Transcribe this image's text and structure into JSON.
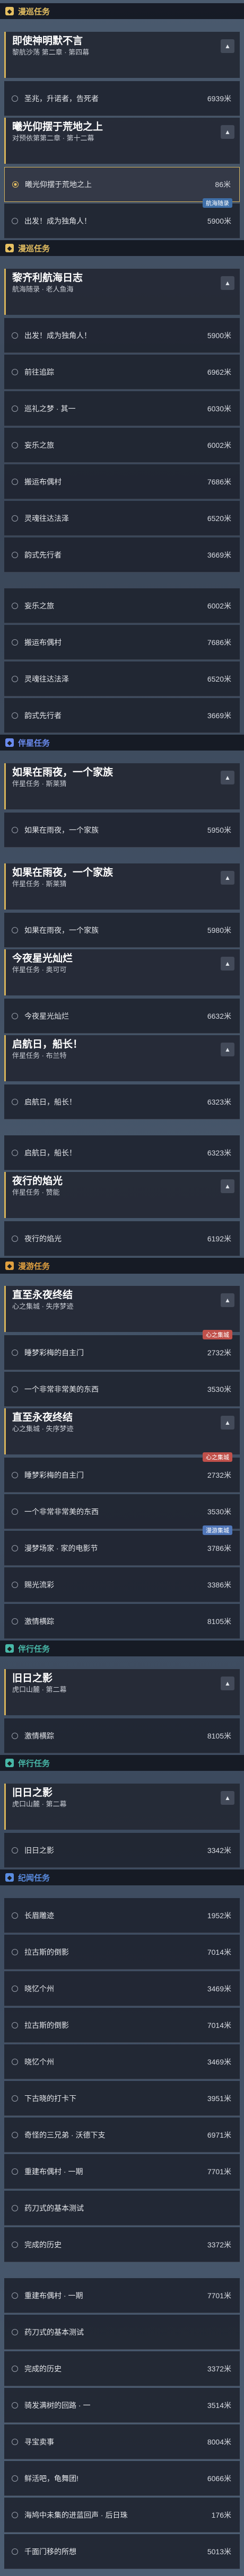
{
  "headers": [
    {
      "label": "漫巡任务",
      "color": "#e6c062",
      "icon": "scroll-icon"
    },
    {
      "label": "漫巡任务",
      "color": "#e6c062",
      "icon": "scroll-icon"
    },
    {
      "label": "伴星任务",
      "color": "#6b8cf0",
      "icon": "star-icon"
    },
    {
      "label": "伴星任务",
      "color": "#8a6cf0",
      "icon": "star-icon"
    },
    {
      "label": "伴星任务",
      "color": "#6b8cf0",
      "icon": "star-icon"
    },
    {
      "label": "伴星任务",
      "color": "#6b8cf0",
      "icon": "star-icon"
    },
    {
      "label": "伴星任务",
      "color": "#6b8cf0",
      "icon": "star-icon"
    },
    {
      "label": "伴星任务",
      "color": "#6b8cf0",
      "icon": "star-icon"
    },
    {
      "label": "伴星任务",
      "color": "#6b8cf0",
      "icon": "star-icon"
    },
    {
      "label": "伴星任务",
      "color": "#6b8cf0",
      "icon": "star-icon"
    },
    {
      "label": "漫游任务",
      "color": "#e0a040",
      "icon": "compass-icon"
    },
    {
      "label": "漫游任务",
      "color": "#e0a040",
      "icon": "compass-icon"
    },
    {
      "label": "漫游任务",
      "color": "#e0a040",
      "icon": "compass-icon"
    },
    {
      "label": "伴行任务",
      "color": "#48b8a8",
      "icon": "footprint-icon"
    },
    {
      "label": "伴行任务",
      "color": "#48b8a8",
      "icon": "footprint-icon"
    },
    {
      "label": "纪闻任务",
      "color": "#5a8ce0",
      "icon": "book-icon"
    }
  ],
  "groups": [
    {
      "title": "即使神明默不言",
      "sub": "黎航沙荡 第二章 · 第四幕"
    },
    {
      "title": "曦光仰摆于荒地之上",
      "sub": "对预依第第二章 · 第十二幕"
    },
    {
      "title": "黎齐利航海日志",
      "sub": "航海随录 · 老人鱼海"
    },
    {
      "title": "黎齐利航海日志",
      "sub": "航海随录 · 老人鱼海"
    },
    {
      "title": "如果在雨夜，一个家族",
      "sub": "伴星任务 · 斯莱猜"
    },
    {
      "title": "如果在雨夜，一个家族",
      "sub": "伴星任务 · 斯莱猜"
    },
    {
      "title": "今夜星光灿烂",
      "sub": "伴星任务 · 奥可可"
    },
    {
      "title": "今夜星光灿烂",
      "sub": "伴星任务 · 奥可可"
    },
    {
      "title": "启航日，船长！",
      "sub": "伴星任务 · 布兰特"
    },
    {
      "title": "夜行的焰光",
      "sub": "伴星任务 · 赞能"
    },
    {
      "title": "夜行的焰光",
      "sub": "伴星任务 · 赞能"
    },
    {
      "title": "直至永夜终结",
      "sub": "心之集城 · 失序梦迹"
    },
    {
      "title": "直至永夜终结",
      "sub": "心之集城 · 失序梦迹"
    },
    {
      "title": "直至永夜终结",
      "sub": "心之集城 · 失序梦迹"
    },
    {
      "title": "旧日之影",
      "sub": "虎口山麓 · 第二幕"
    },
    {
      "title": "旧日之影",
      "sub": "虎口山麓 · 第二幕"
    }
  ],
  "rows": [
    {
      "text": "圣兆，升诺者，告死者",
      "dist": "6939米"
    },
    {
      "text": "曦光仰摆于荒地之上",
      "dist": "86米"
    },
    {
      "text": "出发！成为独角人！",
      "dist": "5900米"
    },
    {
      "text": "出发！成为独角人！",
      "dist": "5900米"
    },
    {
      "text": "前往追踪",
      "dist": "6962米"
    },
    {
      "text": "巡礼之梦 · 其一",
      "dist": "6030米"
    },
    {
      "text": "妄乐之旅",
      "dist": "6002米"
    },
    {
      "text": "搬运布偶村",
      "dist": "7686米"
    },
    {
      "text": "灵魂往达法泽",
      "dist": "6520米"
    },
    {
      "text": "韵式先行者",
      "dist": "3669米"
    },
    {
      "text": "妄乐之旅",
      "dist": "6002米"
    },
    {
      "text": "搬运布偶村",
      "dist": "7686米"
    },
    {
      "text": "灵魂往达法泽",
      "dist": "6520米"
    },
    {
      "text": "韵式先行者",
      "dist": "3669米"
    },
    {
      "text": "如果在雨夜，一个家族",
      "dist": "5950米"
    },
    {
      "text": "如果在雨夜，一个家族",
      "dist": "5980米"
    },
    {
      "text": "今夜星光灿烂",
      "dist": "6632米"
    },
    {
      "text": "启航日，船长！",
      "dist": "6323米"
    },
    {
      "text": "启航日，船长！",
      "dist": "6323米"
    },
    {
      "text": "夜行的焰光",
      "dist": "6192米"
    },
    {
      "text": "睡梦彩梅的自主门",
      "dist": "2732米"
    },
    {
      "text": "一个非常非常美的东西",
      "dist": "3530米"
    },
    {
      "text": "睡梦彩梅的自主门",
      "dist": "2732米"
    },
    {
      "text": "一个非常非常美的东西",
      "dist": "3530米"
    },
    {
      "text": "漫梦场家 · 家的电影节",
      "dist": "3786米"
    },
    {
      "text": "赐光流彩",
      "dist": "3386米"
    },
    {
      "text": "激情横踪",
      "dist": "8105米"
    },
    {
      "text": "激情横踪",
      "dist": "8105米"
    },
    {
      "text": "旧日之影",
      "dist": "3342米"
    },
    {
      "text": "长眉雕迹",
      "dist": "1952米"
    },
    {
      "text": "拉古斯的倒影",
      "dist": "7014米"
    },
    {
      "text": "晓忆个州",
      "dist": "3469米"
    },
    {
      "text": "拉古斯的倒影",
      "dist": "7014米"
    },
    {
      "text": "晓忆个州",
      "dist": "3469米"
    },
    {
      "text": "下古晓的打卡下",
      "dist": "3951米"
    },
    {
      "text": "奇怪的三兄弟 · 沃德下支",
      "dist": "6971米"
    },
    {
      "text": "重建布偶村 · 一期",
      "dist": "7701米"
    },
    {
      "text": "药刀式的基本测试",
      "dist": ""
    },
    {
      "text": "完成的历史",
      "dist": "3372米"
    },
    {
      "text": "重建布偶村 · 一期",
      "dist": "7701米"
    },
    {
      "text": "药刀式的基本测试",
      "dist": ""
    },
    {
      "text": "完成的历史",
      "dist": "3372米"
    },
    {
      "text": "骑发满树的回路 · 一",
      "dist": "3514米"
    },
    {
      "text": "寻宝卖事",
      "dist": "8004米"
    },
    {
      "text": "鲜活吧，龟舞团!",
      "dist": "6066米"
    },
    {
      "text": "海鸠中未集的进蓝回声 · 后日珠",
      "dist": "176米"
    },
    {
      "text": "千面门移的所想",
      "dist": "5013米"
    }
  ],
  "tags": [
    {
      "label": "航海随录",
      "color": "#3f6fa8"
    },
    {
      "label": "心之集城",
      "color": "#c0504a"
    },
    {
      "label": "心之集城",
      "color": "#c0504a"
    },
    {
      "label": "漫游集城",
      "color": "#5076b8"
    },
    {
      "label": "漫梦集城",
      "color": "#5076b8"
    }
  ]
}
